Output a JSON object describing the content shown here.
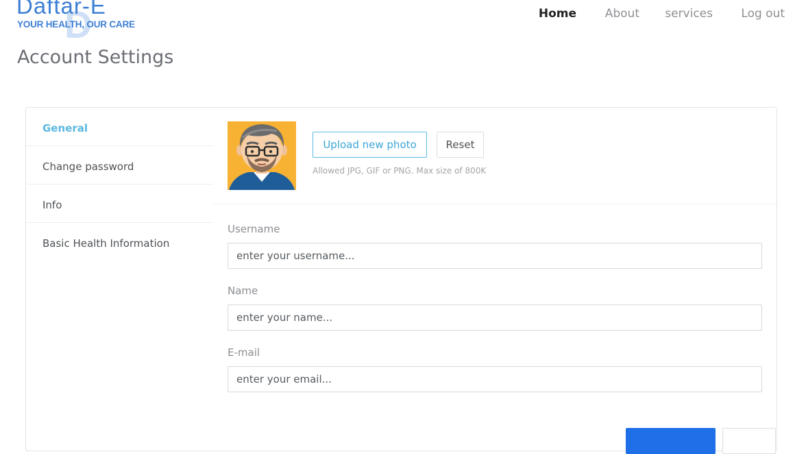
{
  "brand": {
    "name": "Daftar-E",
    "tagline": "YOUR HEALTH, OUR CARE",
    "color": "#3d7fd4"
  },
  "nav": {
    "items": [
      {
        "label": "Home",
        "active": true
      },
      {
        "label": "About",
        "active": false
      },
      {
        "label": "services",
        "active": false
      },
      {
        "label": "Log out",
        "active": false
      }
    ]
  },
  "page": {
    "title": "Account Settings"
  },
  "sidebar": {
    "items": [
      {
        "label": "General",
        "active": true
      },
      {
        "label": "Change password",
        "active": false
      },
      {
        "label": "Info",
        "active": false
      },
      {
        "label": "Basic Health Information",
        "active": false
      }
    ],
    "active_color": "#5bb8e0"
  },
  "photo": {
    "upload_label": "Upload new photo",
    "reset_label": "Reset",
    "hint": "Allowed JPG, GIF or PNG. Max size of 800K"
  },
  "form": {
    "username": {
      "label": "Username",
      "placeholder": "enter your username..."
    },
    "name": {
      "label": "Name",
      "placeholder": "enter your name..."
    },
    "email": {
      "label": "E-mail",
      "placeholder": "enter your email..."
    }
  },
  "colors": {
    "primary_button": "#1e6fe8",
    "avatar_background": "#f7b234"
  }
}
